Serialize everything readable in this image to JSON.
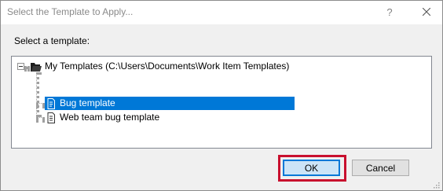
{
  "window": {
    "title": "Select the Template to Apply...",
    "help_label": "?",
    "close_icon": "close-icon"
  },
  "prompt": "Select a template:",
  "tree": {
    "root": {
      "label": "My Templates (C:\\Users\\Documents\\Work Item Templates)",
      "expanded": true,
      "icon": "folder-icon"
    },
    "children": [
      {
        "label": "Bug template",
        "selected": true,
        "icon": "template-file-icon"
      },
      {
        "label": "Web team bug template",
        "selected": false,
        "icon": "document-icon"
      }
    ]
  },
  "buttons": {
    "ok_label": "OK",
    "cancel_label": "Cancel"
  },
  "colors": {
    "selection": "#0078d7",
    "highlight_box": "#c8102e",
    "dialog_bg": "#f0f0f0"
  }
}
